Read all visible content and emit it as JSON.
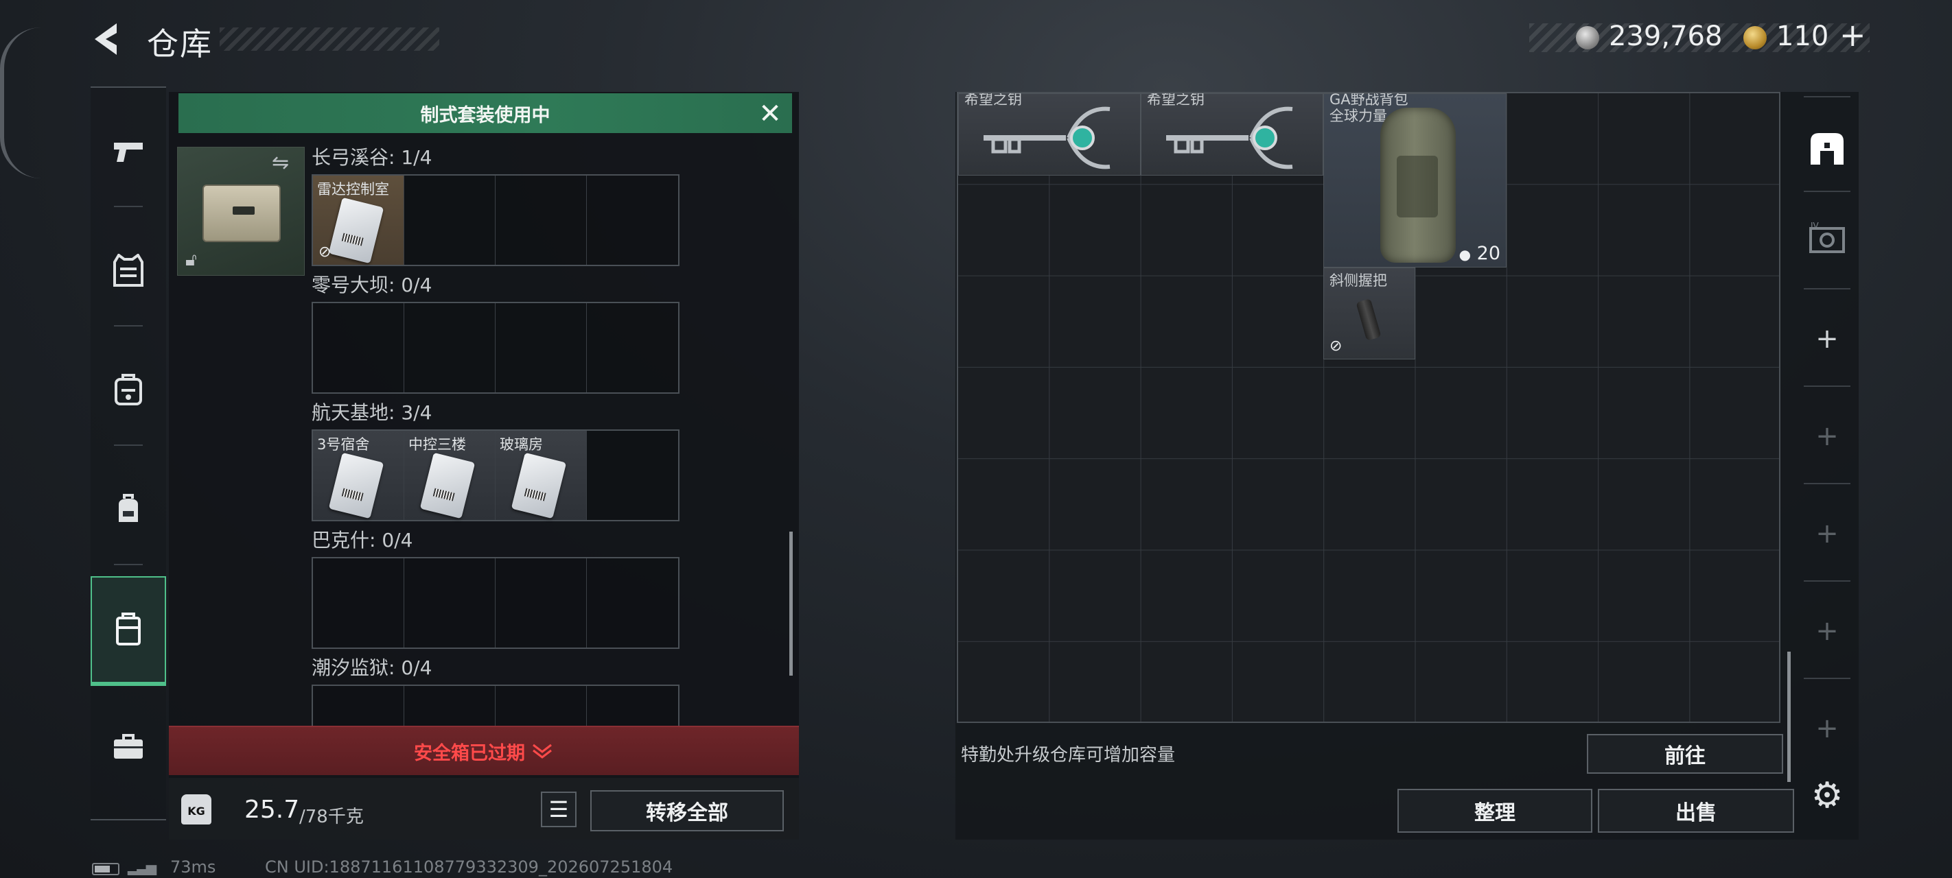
{
  "header": {
    "title": "仓库",
    "currency1": "239,768",
    "currency2": "110",
    "currency2_plus": "+"
  },
  "rail": {
    "items": [
      "pistol-icon",
      "armor-vest-icon",
      "chest-rig-icon",
      "backpack-icon",
      "safe-case-icon",
      "toolbox-icon"
    ]
  },
  "left_panel": {
    "banner": "制式套装使用中",
    "sections": [
      {
        "label": "长弓溪谷: 1/4",
        "items": [
          {
            "name": "雷达控制室"
          }
        ]
      },
      {
        "label": "零号大坝: 0/4",
        "items": []
      },
      {
        "label": "航天基地: 3/4",
        "items": [
          {
            "name": "3号宿舍"
          },
          {
            "name": "中控三楼"
          },
          {
            "name": "玻璃房"
          }
        ]
      },
      {
        "label": "巴克什: 0/4",
        "items": []
      },
      {
        "label": "潮汐监狱: 0/4",
        "items": []
      }
    ],
    "safebox_status": "安全箱已过期",
    "weight_value": "25.7",
    "weight_max": "/78千克",
    "transfer_all": "转移全部"
  },
  "stash": {
    "items": [
      {
        "name": "希望之钥"
      },
      {
        "name": "希望之钥"
      },
      {
        "name": "GA野战背包",
        "name2": "全球力量",
        "count": "20"
      },
      {
        "name": "斜侧握把"
      }
    ],
    "hint": "特勤处升级仓库可增加容量",
    "goto": "前往",
    "sort": "整理",
    "sell": "出售"
  },
  "side_rail": {
    "tab_labels": [
      "+",
      "+",
      "+",
      "+",
      "+"
    ]
  },
  "footer": {
    "ping": "73ms",
    "uid": "CN UID:18871161108779332309_202607251804"
  },
  "colors": {
    "accent_green": "#4fc08a",
    "banner_green": "#2f7a57",
    "alert_red": "#ff4a4a"
  }
}
